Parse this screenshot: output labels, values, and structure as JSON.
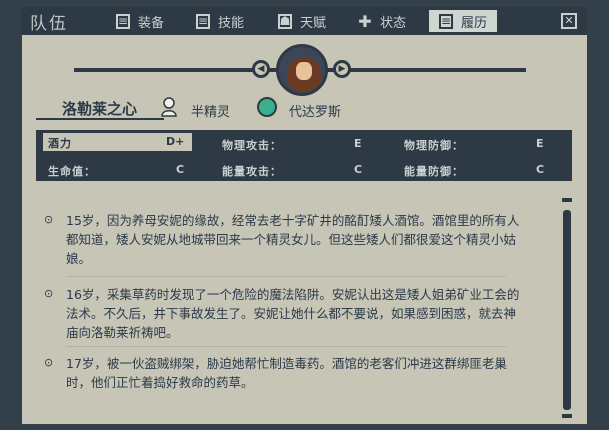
{
  "header": {
    "team_title": "队伍",
    "tabs": [
      {
        "label": "装备",
        "icon": "equipment-icon",
        "active": false
      },
      {
        "label": "技能",
        "icon": "skills-icon",
        "active": false
      },
      {
        "label": "天赋",
        "icon": "talent-icon",
        "active": false
      },
      {
        "label": "状态",
        "icon": "status-icon",
        "active": false
      },
      {
        "label": "履历",
        "icon": "history-icon",
        "active": true
      }
    ],
    "close_icon": "close-icon"
  },
  "character": {
    "name": "洛勒莱之心",
    "race": "半精灵",
    "realm": "代达罗斯"
  },
  "stats": [
    {
      "label": "酒力",
      "value": "D+"
    },
    {
      "label": "物理攻击：",
      "value": "E"
    },
    {
      "label": "物理防御：",
      "value": "E"
    },
    {
      "label": "生命值：",
      "value": "C"
    },
    {
      "label": "能量攻击：",
      "value": "C"
    },
    {
      "label": "能量防御：",
      "value": "C"
    }
  ],
  "history": [
    "15岁，因为养母安妮的缘故，经常去老十字矿井的酩酊矮人酒馆。酒馆里的所有人都知道，矮人安妮从地城带回来一个精灵女儿。但这些矮人们都很爱这个精灵小姑娘。",
    "16岁，采集草药时发现了一个危险的魔法陷阱。安妮认出这是矮人姐弟矿业工会的法术。不久后，井下事故发生了。安妮让她什么都不要说，如果感到困惑，就去神庙向洛勒莱祈祷吧。",
    "17岁，被一伙盗贼绑架，胁迫她帮忙制造毒药。酒馆的老客们冲进这群绑匪老巢时，他们正忙着捣好救命的药草。"
  ],
  "colors": {
    "panel": "#c6c5b6",
    "frame": "#2d3a45",
    "accent_green": "#3bb08a"
  }
}
